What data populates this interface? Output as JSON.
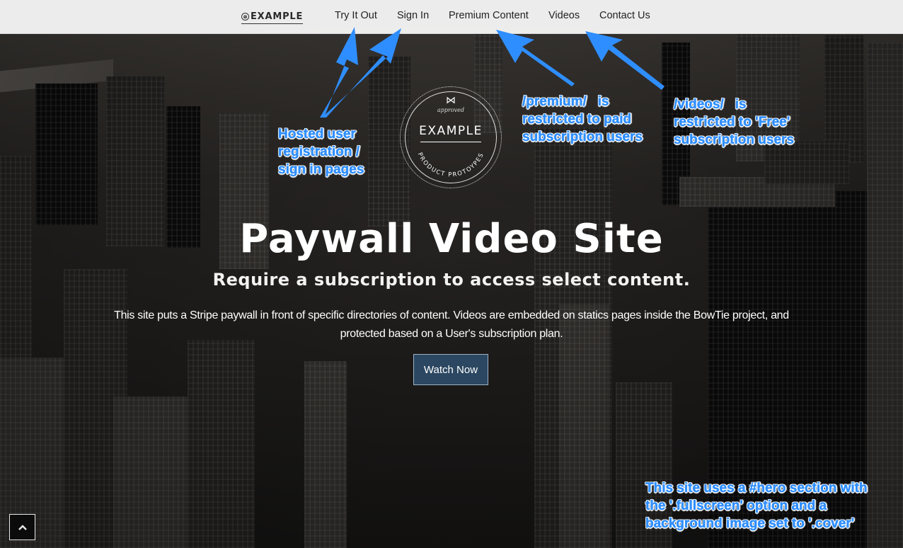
{
  "navbar": {
    "brand": {
      "icon": "bowtie-face-icon",
      "icon_glyph": "⊗",
      "text": "EXAMPLE"
    },
    "links": [
      {
        "label": "Try It Out"
      },
      {
        "label": "Sign In"
      },
      {
        "label": "Premium Content"
      },
      {
        "label": "Videos"
      },
      {
        "label": "Contact Us"
      }
    ]
  },
  "badge": {
    "icon": "bowtie-icon",
    "icon_glyph": "⋈",
    "approved": "approved",
    "title": "EXAMPLE",
    "subtitle": "PRODUCT PROTOYPES"
  },
  "hero": {
    "title": "Paywall Video Site",
    "subtitle": "Require a subscription to access select content.",
    "description": "This site puts a Stripe paywall in front of specific directories of content. Videos are embedded on statics pages inside the BowTie project, and protected based on a User's subscription plan.",
    "cta_label": "Watch Now",
    "scroll_top_icon": "chevron-up-icon"
  },
  "annotations": {
    "color": "#2f8eff",
    "hosted": "Hosted user\nregistration /\nsign in pages",
    "premium": "/premium/   is\nrestricted to paid\nsubscription users",
    "videos": "/videos/   is\nrestricted to 'Free'\nsubscription users",
    "hero_note": "This site uses a #hero section with\nthe '.fullscreen' option and a\nbackground image set to '.cover'"
  },
  "colors": {
    "navbar_bg": "#f5f5f5",
    "cta_bg": "#2b4761",
    "annotation": "#2f8eff"
  }
}
